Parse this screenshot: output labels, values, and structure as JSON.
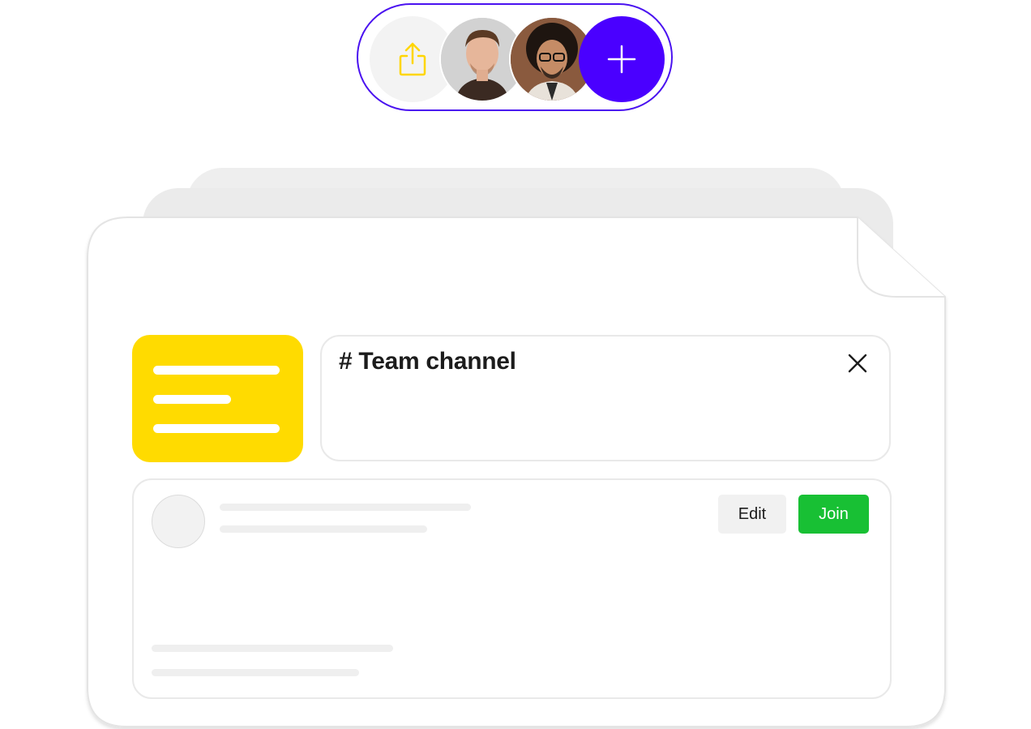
{
  "toolbar": {
    "share_icon": "share-upload-icon",
    "avatars": [
      {
        "name": "avatar-person-1"
      },
      {
        "name": "avatar-person-2"
      }
    ],
    "add_icon": "plus-icon",
    "colors": {
      "border": "#4a12f0",
      "add_button": "#4a00ff",
      "share_icon": "#ffd600"
    }
  },
  "channel": {
    "title": "# Team channel",
    "close_icon": "close-icon"
  },
  "doc_tile": {
    "icon": "document-lines-icon",
    "color": "#ffdb00"
  },
  "post": {
    "edit_label": "Edit",
    "join_label": "Join",
    "colors": {
      "join": "#18c034",
      "edit": "#f1f1f1"
    }
  }
}
